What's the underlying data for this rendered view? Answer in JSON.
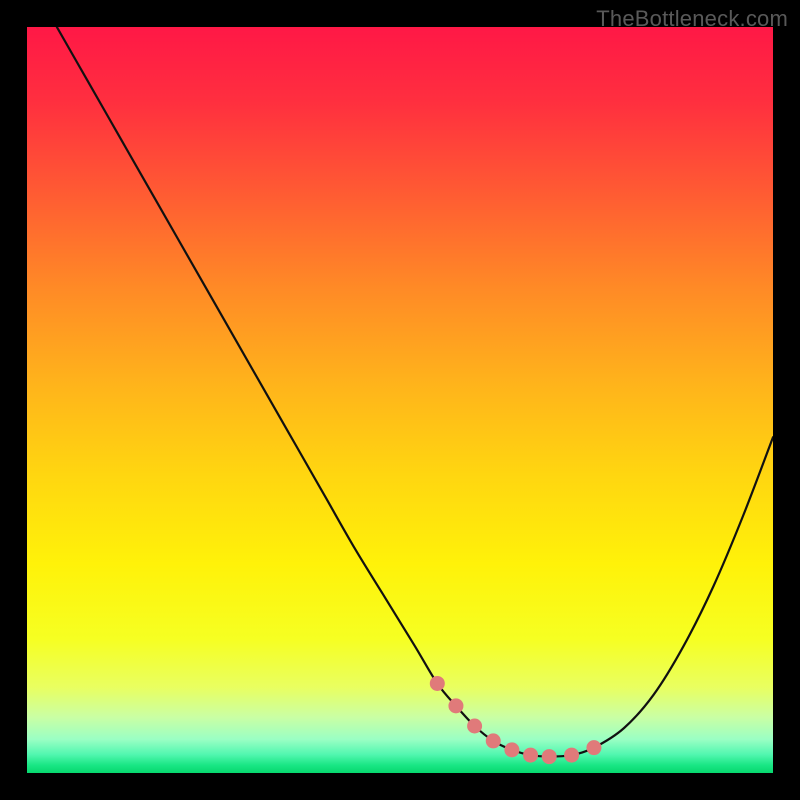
{
  "watermark": "TheBottleneck.com",
  "colors": {
    "frame": "#000000",
    "curve_stroke": "#111111",
    "marker_fill": "#e07a7a",
    "gradient_stops": [
      {
        "offset": 0.0,
        "color": "#ff1846"
      },
      {
        "offset": 0.1,
        "color": "#ff2f3f"
      },
      {
        "offset": 0.22,
        "color": "#ff5a33"
      },
      {
        "offset": 0.35,
        "color": "#ff8a26"
      },
      {
        "offset": 0.48,
        "color": "#ffb41b"
      },
      {
        "offset": 0.6,
        "color": "#ffd610"
      },
      {
        "offset": 0.72,
        "color": "#fff209"
      },
      {
        "offset": 0.82,
        "color": "#f6ff22"
      },
      {
        "offset": 0.885,
        "color": "#e9ff60"
      },
      {
        "offset": 0.925,
        "color": "#caffa4"
      },
      {
        "offset": 0.955,
        "color": "#9affc4"
      },
      {
        "offset": 0.975,
        "color": "#52f7b0"
      },
      {
        "offset": 0.99,
        "color": "#18e683"
      },
      {
        "offset": 1.0,
        "color": "#07d86f"
      }
    ]
  },
  "chart_data": {
    "type": "line",
    "title": "",
    "xlabel": "",
    "ylabel": "",
    "xlim": [
      0,
      100
    ],
    "ylim": [
      0,
      100
    ],
    "series": [
      {
        "name": "bottleneck-curve",
        "x": [
          4,
          8,
          12,
          16,
          20,
          24,
          28,
          32,
          36,
          40,
          44,
          48,
          52,
          55,
          57.5,
          60,
          62.5,
          65,
          67.5,
          70,
          73,
          76,
          80,
          84,
          88,
          92,
          96,
          100
        ],
        "values": [
          100,
          93,
          86,
          79,
          72,
          65,
          58,
          51,
          44,
          37,
          30,
          23.5,
          17,
          12,
          9,
          6.3,
          4.3,
          3.1,
          2.4,
          2.2,
          2.4,
          3.4,
          6,
          10.5,
          17,
          25,
          34.5,
          45
        ]
      }
    ],
    "markers": {
      "name": "highlight-range",
      "x": [
        55,
        57.5,
        60,
        62.5,
        65,
        67.5,
        70,
        73,
        76
      ],
      "values": [
        12,
        9,
        6.3,
        4.3,
        3.1,
        2.4,
        2.2,
        2.4,
        3.4
      ]
    }
  }
}
